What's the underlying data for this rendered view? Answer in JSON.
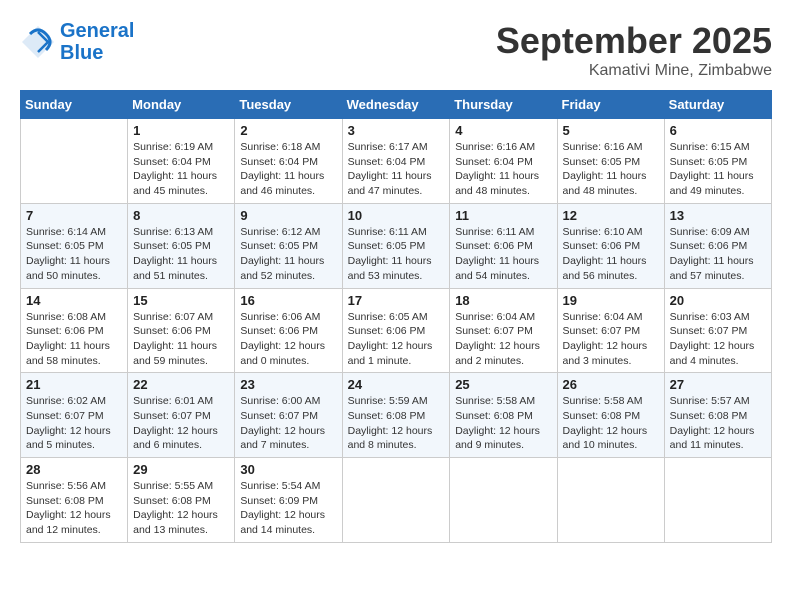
{
  "header": {
    "logo_line1": "General",
    "logo_line2": "Blue",
    "month": "September 2025",
    "location": "Kamativi Mine, Zimbabwe"
  },
  "weekdays": [
    "Sunday",
    "Monday",
    "Tuesday",
    "Wednesday",
    "Thursday",
    "Friday",
    "Saturday"
  ],
  "weeks": [
    [
      {
        "day": "",
        "info": ""
      },
      {
        "day": "1",
        "info": "Sunrise: 6:19 AM\nSunset: 6:04 PM\nDaylight: 11 hours\nand 45 minutes."
      },
      {
        "day": "2",
        "info": "Sunrise: 6:18 AM\nSunset: 6:04 PM\nDaylight: 11 hours\nand 46 minutes."
      },
      {
        "day": "3",
        "info": "Sunrise: 6:17 AM\nSunset: 6:04 PM\nDaylight: 11 hours\nand 47 minutes."
      },
      {
        "day": "4",
        "info": "Sunrise: 6:16 AM\nSunset: 6:04 PM\nDaylight: 11 hours\nand 48 minutes."
      },
      {
        "day": "5",
        "info": "Sunrise: 6:16 AM\nSunset: 6:05 PM\nDaylight: 11 hours\nand 48 minutes."
      },
      {
        "day": "6",
        "info": "Sunrise: 6:15 AM\nSunset: 6:05 PM\nDaylight: 11 hours\nand 49 minutes."
      }
    ],
    [
      {
        "day": "7",
        "info": "Sunrise: 6:14 AM\nSunset: 6:05 PM\nDaylight: 11 hours\nand 50 minutes."
      },
      {
        "day": "8",
        "info": "Sunrise: 6:13 AM\nSunset: 6:05 PM\nDaylight: 11 hours\nand 51 minutes."
      },
      {
        "day": "9",
        "info": "Sunrise: 6:12 AM\nSunset: 6:05 PM\nDaylight: 11 hours\nand 52 minutes."
      },
      {
        "day": "10",
        "info": "Sunrise: 6:11 AM\nSunset: 6:05 PM\nDaylight: 11 hours\nand 53 minutes."
      },
      {
        "day": "11",
        "info": "Sunrise: 6:11 AM\nSunset: 6:06 PM\nDaylight: 11 hours\nand 54 minutes."
      },
      {
        "day": "12",
        "info": "Sunrise: 6:10 AM\nSunset: 6:06 PM\nDaylight: 11 hours\nand 56 minutes."
      },
      {
        "day": "13",
        "info": "Sunrise: 6:09 AM\nSunset: 6:06 PM\nDaylight: 11 hours\nand 57 minutes."
      }
    ],
    [
      {
        "day": "14",
        "info": "Sunrise: 6:08 AM\nSunset: 6:06 PM\nDaylight: 11 hours\nand 58 minutes."
      },
      {
        "day": "15",
        "info": "Sunrise: 6:07 AM\nSunset: 6:06 PM\nDaylight: 11 hours\nand 59 minutes."
      },
      {
        "day": "16",
        "info": "Sunrise: 6:06 AM\nSunset: 6:06 PM\nDaylight: 12 hours\nand 0 minutes."
      },
      {
        "day": "17",
        "info": "Sunrise: 6:05 AM\nSunset: 6:06 PM\nDaylight: 12 hours\nand 1 minute."
      },
      {
        "day": "18",
        "info": "Sunrise: 6:04 AM\nSunset: 6:07 PM\nDaylight: 12 hours\nand 2 minutes."
      },
      {
        "day": "19",
        "info": "Sunrise: 6:04 AM\nSunset: 6:07 PM\nDaylight: 12 hours\nand 3 minutes."
      },
      {
        "day": "20",
        "info": "Sunrise: 6:03 AM\nSunset: 6:07 PM\nDaylight: 12 hours\nand 4 minutes."
      }
    ],
    [
      {
        "day": "21",
        "info": "Sunrise: 6:02 AM\nSunset: 6:07 PM\nDaylight: 12 hours\nand 5 minutes."
      },
      {
        "day": "22",
        "info": "Sunrise: 6:01 AM\nSunset: 6:07 PM\nDaylight: 12 hours\nand 6 minutes."
      },
      {
        "day": "23",
        "info": "Sunrise: 6:00 AM\nSunset: 6:07 PM\nDaylight: 12 hours\nand 7 minutes."
      },
      {
        "day": "24",
        "info": "Sunrise: 5:59 AM\nSunset: 6:08 PM\nDaylight: 12 hours\nand 8 minutes."
      },
      {
        "day": "25",
        "info": "Sunrise: 5:58 AM\nSunset: 6:08 PM\nDaylight: 12 hours\nand 9 minutes."
      },
      {
        "day": "26",
        "info": "Sunrise: 5:58 AM\nSunset: 6:08 PM\nDaylight: 12 hours\nand 10 minutes."
      },
      {
        "day": "27",
        "info": "Sunrise: 5:57 AM\nSunset: 6:08 PM\nDaylight: 12 hours\nand 11 minutes."
      }
    ],
    [
      {
        "day": "28",
        "info": "Sunrise: 5:56 AM\nSunset: 6:08 PM\nDaylight: 12 hours\nand 12 minutes."
      },
      {
        "day": "29",
        "info": "Sunrise: 5:55 AM\nSunset: 6:08 PM\nDaylight: 12 hours\nand 13 minutes."
      },
      {
        "day": "30",
        "info": "Sunrise: 5:54 AM\nSunset: 6:09 PM\nDaylight: 12 hours\nand 14 minutes."
      },
      {
        "day": "",
        "info": ""
      },
      {
        "day": "",
        "info": ""
      },
      {
        "day": "",
        "info": ""
      },
      {
        "day": "",
        "info": ""
      }
    ]
  ]
}
